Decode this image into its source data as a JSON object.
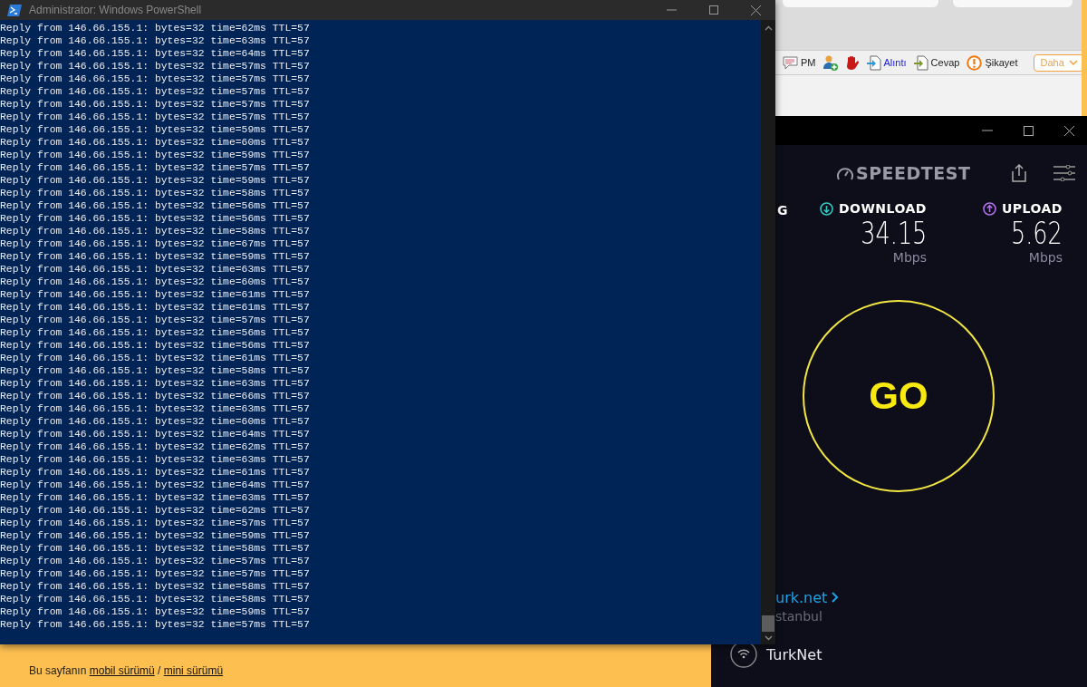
{
  "powershell": {
    "title": "Administrator: Windows PowerShell",
    "lines": [
      "Reply from 146.66.155.1: bytes=32 time=62ms TTL=57",
      "Reply from 146.66.155.1: bytes=32 time=63ms TTL=57",
      "Reply from 146.66.155.1: bytes=32 time=64ms TTL=57",
      "Reply from 146.66.155.1: bytes=32 time=57ms TTL=57",
      "Reply from 146.66.155.1: bytes=32 time=57ms TTL=57",
      "Reply from 146.66.155.1: bytes=32 time=57ms TTL=57",
      "Reply from 146.66.155.1: bytes=32 time=57ms TTL=57",
      "Reply from 146.66.155.1: bytes=32 time=57ms TTL=57",
      "Reply from 146.66.155.1: bytes=32 time=59ms TTL=57",
      "Reply from 146.66.155.1: bytes=32 time=60ms TTL=57",
      "Reply from 146.66.155.1: bytes=32 time=59ms TTL=57",
      "Reply from 146.66.155.1: bytes=32 time=57ms TTL=57",
      "Reply from 146.66.155.1: bytes=32 time=59ms TTL=57",
      "Reply from 146.66.155.1: bytes=32 time=58ms TTL=57",
      "Reply from 146.66.155.1: bytes=32 time=56ms TTL=57",
      "Reply from 146.66.155.1: bytes=32 time=56ms TTL=57",
      "Reply from 146.66.155.1: bytes=32 time=58ms TTL=57",
      "Reply from 146.66.155.1: bytes=32 time=67ms TTL=57",
      "Reply from 146.66.155.1: bytes=32 time=59ms TTL=57",
      "Reply from 146.66.155.1: bytes=32 time=63ms TTL=57",
      "Reply from 146.66.155.1: bytes=32 time=60ms TTL=57",
      "Reply from 146.66.155.1: bytes=32 time=61ms TTL=57",
      "Reply from 146.66.155.1: bytes=32 time=61ms TTL=57",
      "Reply from 146.66.155.1: bytes=32 time=57ms TTL=57",
      "Reply from 146.66.155.1: bytes=32 time=56ms TTL=57",
      "Reply from 146.66.155.1: bytes=32 time=56ms TTL=57",
      "Reply from 146.66.155.1: bytes=32 time=61ms TTL=57",
      "Reply from 146.66.155.1: bytes=32 time=58ms TTL=57",
      "Reply from 146.66.155.1: bytes=32 time=63ms TTL=57",
      "Reply from 146.66.155.1: bytes=32 time=66ms TTL=57",
      "Reply from 146.66.155.1: bytes=32 time=63ms TTL=57",
      "Reply from 146.66.155.1: bytes=32 time=60ms TTL=57",
      "Reply from 146.66.155.1: bytes=32 time=64ms TTL=57",
      "Reply from 146.66.155.1: bytes=32 time=62ms TTL=57",
      "Reply from 146.66.155.1: bytes=32 time=63ms TTL=57",
      "Reply from 146.66.155.1: bytes=32 time=61ms TTL=57",
      "Reply from 146.66.155.1: bytes=32 time=64ms TTL=57",
      "Reply from 146.66.155.1: bytes=32 time=63ms TTL=57",
      "Reply from 146.66.155.1: bytes=32 time=62ms TTL=57",
      "Reply from 146.66.155.1: bytes=32 time=57ms TTL=57",
      "Reply from 146.66.155.1: bytes=32 time=59ms TTL=57",
      "Reply from 146.66.155.1: bytes=32 time=58ms TTL=57",
      "Reply from 146.66.155.1: bytes=32 time=57ms TTL=57",
      "Reply from 146.66.155.1: bytes=32 time=57ms TTL=57",
      "Reply from 146.66.155.1: bytes=32 time=58ms TTL=57",
      "Reply from 146.66.155.1: bytes=32 time=58ms TTL=57",
      "Reply from 146.66.155.1: bytes=32 time=59ms TTL=57",
      "Reply from 146.66.155.1: bytes=32 time=57ms TTL=57"
    ]
  },
  "browser": {
    "toolbar": [
      {
        "kind": "pm",
        "label": "PM"
      },
      {
        "kind": "add-user"
      },
      {
        "kind": "block"
      },
      {
        "kind": "quote",
        "label": "Alıntı"
      },
      {
        "kind": "reply",
        "label": "Cevap"
      },
      {
        "kind": "report",
        "label": "Şikayet"
      }
    ],
    "more_button": "Daha",
    "footer": {
      "text": "Bu sayfanın",
      "links": [
        "mobil sürümü",
        "mini sürümü"
      ],
      "separator": "/"
    }
  },
  "speedtest": {
    "logo": "SPEEDTEST",
    "ping_label": "G",
    "metrics": [
      {
        "kind": "download",
        "label": "DOWNLOAD",
        "value": "34.15",
        "unit": "Mbps"
      },
      {
        "kind": "upload",
        "label": "UPLOAD",
        "value": "5.62",
        "unit": "Mbps"
      }
    ],
    "go": "GO",
    "server": {
      "name": "urk.net",
      "location": "stanbul"
    },
    "provider": "TurkNet"
  }
}
